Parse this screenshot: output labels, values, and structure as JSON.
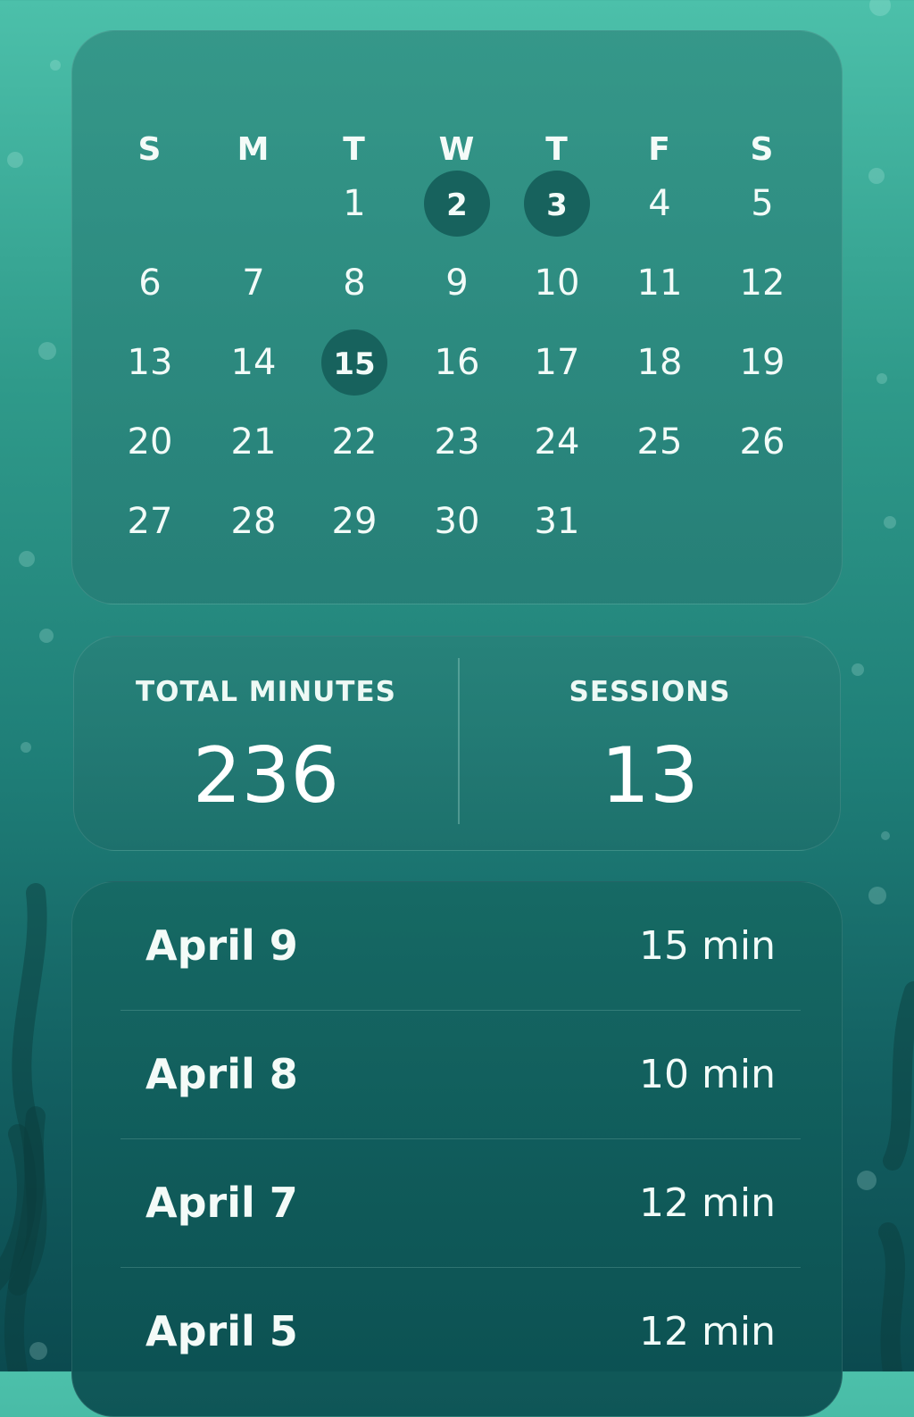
{
  "calendar": {
    "weekdays": [
      "S",
      "M",
      "T",
      "W",
      "T",
      "F",
      "S"
    ],
    "days": [
      "",
      "",
      "1",
      "2",
      "3",
      "4",
      "5",
      "6",
      "7",
      "8",
      "9",
      "10",
      "11",
      "12",
      "13",
      "14",
      "15",
      "16",
      "17",
      "18",
      "19",
      "20",
      "21",
      "22",
      "23",
      "24",
      "25",
      "26",
      "27",
      "28",
      "29",
      "30",
      "31",
      "",
      ""
    ],
    "marked_days": [
      "2",
      "3",
      "15"
    ]
  },
  "stats": {
    "total_minutes_label": "TOTAL MINUTES",
    "total_minutes_value": "236",
    "sessions_label": "SESSIONS",
    "sessions_value": "13"
  },
  "sessions": [
    {
      "date": "April 9",
      "duration": "15 min"
    },
    {
      "date": "April 8",
      "duration": "10 min"
    },
    {
      "date": "April 7",
      "duration": "12 min"
    },
    {
      "date": "April 5",
      "duration": "12 min"
    }
  ],
  "colors": {
    "background_top": "#4cc0aa",
    "background_bottom": "#0b4a4f",
    "marked_day": "#17625d",
    "text": "#f2fbf8"
  }
}
